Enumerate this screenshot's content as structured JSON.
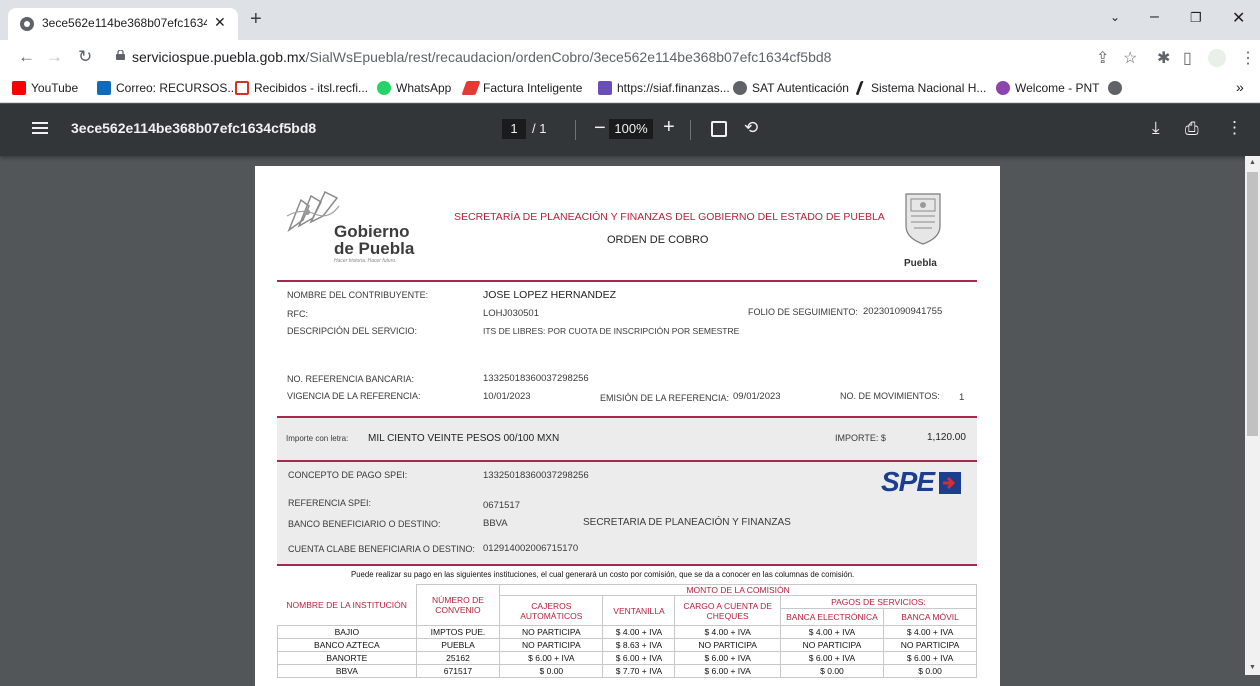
{
  "browser": {
    "tab_title": "3ece562e114be368b07efc1634cf5bd8",
    "url_domain": "serviciospue.puebla.gob.mx",
    "url_path": "/SialWsEpuebla/rest/recaudacion/ordenCobro/3ece562e114be368b07efc1634cf5bd8",
    "bookmarks": [
      {
        "label": "YouTube",
        "color": "#ff0000"
      },
      {
        "label": "Correo: RECURSOS...",
        "color": "#0f6cbd"
      },
      {
        "label": "Recibidos - itsl.recfi...",
        "color": "#d93025"
      },
      {
        "label": "WhatsApp",
        "color": "#25d366"
      },
      {
        "label": "Factura Inteligente",
        "color": "#e53935"
      },
      {
        "label": "https://siaf.finanzas...",
        "color": "#6a4fb8"
      },
      {
        "label": "SAT Autenticación",
        "color": "#5f6368"
      },
      {
        "label": "Sistema Nacional H...",
        "color": "#202124"
      },
      {
        "label": "Welcome - PNT",
        "color": "#8e44ad"
      }
    ],
    "bookmarks_more": "»"
  },
  "pdf": {
    "filename": "3ece562e114be368b07efc1634cf5bd8",
    "current_page": "1",
    "total_pages": "/ 1",
    "zoom": "100%"
  },
  "doc": {
    "logo_title_1": "Gobierno",
    "logo_title_2": "de Puebla",
    "logo_tagline": "Hacer historia. Hacer futuro.",
    "seal_label": "Puebla",
    "header_line1": "SECRETARÍA DE PLANEACIÓN Y FINANZAS DEL GOBIERNO DEL ESTADO DE PUEBLA",
    "header_line2": "ORDEN DE COBRO",
    "fields": {
      "contribuyente_label": "NOMBRE DEL CONTRIBUYENTE:",
      "contribuyente_value": "JOSE LOPEZ HERNANDEZ",
      "rfc_label": "RFC:",
      "rfc_value": "LOHJ030501",
      "folio_label": "FOLIO DE SEGUIMIENTO:",
      "folio_value": "202301090941755",
      "descripcion_label": "DESCRIPCIÓN DEL SERVICIO:",
      "descripcion_value": "ITS DE LIBRES: POR CUOTA DE INSCRIPCIÓN POR SEMESTRE",
      "referencia_label": "NO. REFERENCIA BANCARIA:",
      "referencia_value": "13325018360037298256",
      "vigencia_label": "VIGENCIA DE LA REFERENCIA:",
      "vigencia_value": "10/01/2023",
      "emision_label": "EMISIÓN DE LA REFERENCIA:",
      "emision_value": "09/01/2023",
      "movimientos_label": "NO. DE MOVIMIENTOS:",
      "movimientos_value": "1"
    },
    "importe": {
      "letra_label": "Importe con letra:",
      "letra_value": "MIL CIENTO VEINTE  PESOS 00/100 MXN",
      "importe_label": "IMPORTE: $",
      "importe_value": "1,120.00"
    },
    "spei": {
      "logo": "SPE",
      "concepto_label": "CONCEPTO DE PAGO SPEI:",
      "concepto_value": "13325018360037298256",
      "referencia_label": "REFERENCIA SPEI:",
      "referencia_value": "0671517",
      "banco_label": "BANCO BENEFICIARIO O DESTINO:",
      "banco_value": "BBVA",
      "banco_titular": "SECRETARIA DE PLANEACIÓN Y FINANZAS",
      "clabe_label": "CUENTA CLABE BENEFICIARIA O DESTINO:",
      "clabe_value": "012914002006715170"
    },
    "table": {
      "note": "Puede realizar su pago en las siguientes instituciones, el cual generará un costo por comisión, que se da a conocer en las columnas de comisión.",
      "monto_header": "MONTO DE LA COMISIÓN",
      "pagos_header": "PAGOS DE SERVICIOS:",
      "col_institucion": "NOMBRE DE LA INSTITUCIÓN",
      "col_convenio": "NÚMERO DE CONVENIO",
      "col_cajeros": "CAJEROS AUTOMÁTICOS",
      "col_ventanilla": "VENTANILLA",
      "col_cheques": "CARGO A CUENTA DE CHEQUES",
      "col_electronica": "BANCA ELECTRÓNICA",
      "col_movil": "BANCA MÓVIL",
      "rows": [
        {
          "inst": "BAJIO",
          "conv": "IMPTOS PUE.",
          "caj": "NO PARTICIPA",
          "ven": "$ 4.00 + IVA",
          "che": "$ 4.00 + IVA",
          "ele": "$ 4.00 + IVA",
          "mov": "$ 4.00 + IVA"
        },
        {
          "inst": "BANCO AZTECA",
          "conv": "PUEBLA",
          "caj": "NO PARTICIPA",
          "ven": "$ 8.63 + IVA",
          "che": "NO PARTICIPA",
          "ele": "NO PARTICIPA",
          "mov": "NO PARTICIPA"
        },
        {
          "inst": "BANORTE",
          "conv": "25162",
          "caj": "$ 6.00 + IVA",
          "ven": "$ 6.00 + IVA",
          "che": "$ 6.00 + IVA",
          "ele": "$ 6.00 + IVA",
          "mov": "$ 6.00 + IVA"
        },
        {
          "inst": "BBVA",
          "conv": "671517",
          "caj": "$ 0.00",
          "ven": "$ 7.70 + IVA",
          "che": "$ 6.00 + IVA",
          "ele": "$ 0.00",
          "mov": "$ 0.00"
        }
      ]
    }
  },
  "colors": {
    "accent": "#b8213e",
    "spei_blue": "#1d3d8f",
    "spei_red": "#d32f2f"
  }
}
